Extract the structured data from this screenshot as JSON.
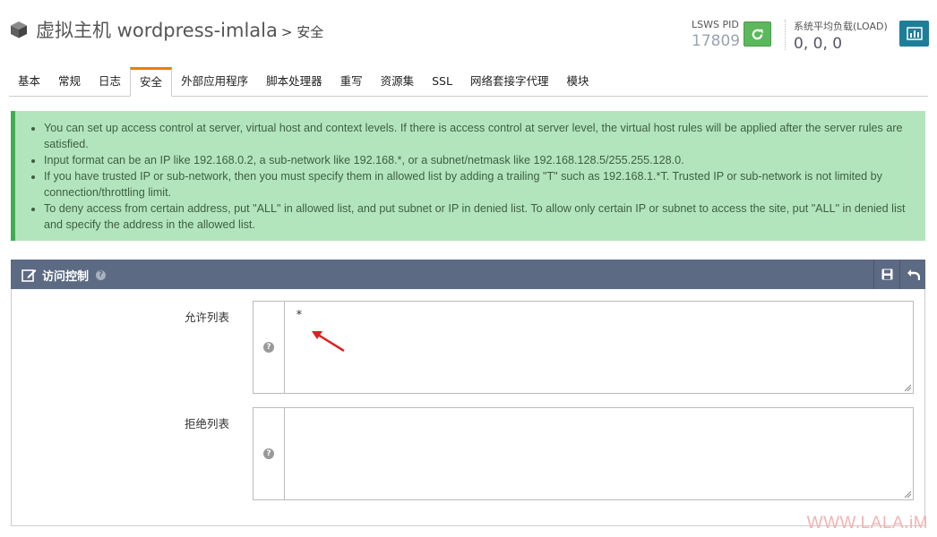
{
  "header": {
    "title": "虚拟主机 wordpress-imlala",
    "breadcrumb_sep": ">",
    "breadcrumb_current": "安全",
    "pid_label": "LSWS PID",
    "pid_value": "17809",
    "load_label": "系统平均负载(LOAD)",
    "load_value": "0, 0, 0"
  },
  "tabs": [
    {
      "label": "基本"
    },
    {
      "label": "常规"
    },
    {
      "label": "日志"
    },
    {
      "label": "安全",
      "active": true
    },
    {
      "label": "外部应用程序"
    },
    {
      "label": "脚本处理器"
    },
    {
      "label": "重写"
    },
    {
      "label": "资源集"
    },
    {
      "label": "SSL"
    },
    {
      "label": "网络套接字代理"
    },
    {
      "label": "模块"
    }
  ],
  "info": {
    "items": [
      "You can set up access control at server, virtual host and context levels. If there is access control at server level, the virtual host rules will be applied after the server rules are satisfied.",
      "Input format can be an IP like 192.168.0.2, a sub-network like 192.168.*, or a subnet/netmask like 192.168.128.5/255.255.128.0.",
      "If you have trusted IP or sub-network, then you must specify them in allowed list by adding a trailing \"T\" such as 192.168.1.*T. Trusted IP or sub-network is not limited by connection/throttling limit.",
      "To deny access from certain address, put \"ALL\" in allowed list, and put subnet or IP in denied list. To allow only certain IP or subnet to access the site, put \"ALL\" in denied list and specify the address in the allowed list."
    ]
  },
  "panel": {
    "title": "访问控制",
    "help_glyph": "?",
    "fields": {
      "allowed_label": "允许列表",
      "allowed_value": "*",
      "denied_label": "拒绝列表",
      "denied_value": ""
    }
  },
  "watermark": "WWW.LALA.iM",
  "colors": {
    "accent_tab": "#e87e04",
    "info_bg": "#b3e5bd",
    "info_border": "#3fae52",
    "panel_head": "#5d6a83",
    "restart_button": "#5cb85c",
    "stats_button": "#1e7e98",
    "annotation_arrow": "#e02020"
  },
  "icons": {
    "title": "cube-icon",
    "restart": "refresh-icon",
    "stats": "bar-chart-icon",
    "panel_title": "edit-icon",
    "save": "save-icon",
    "back": "undo-icon"
  }
}
